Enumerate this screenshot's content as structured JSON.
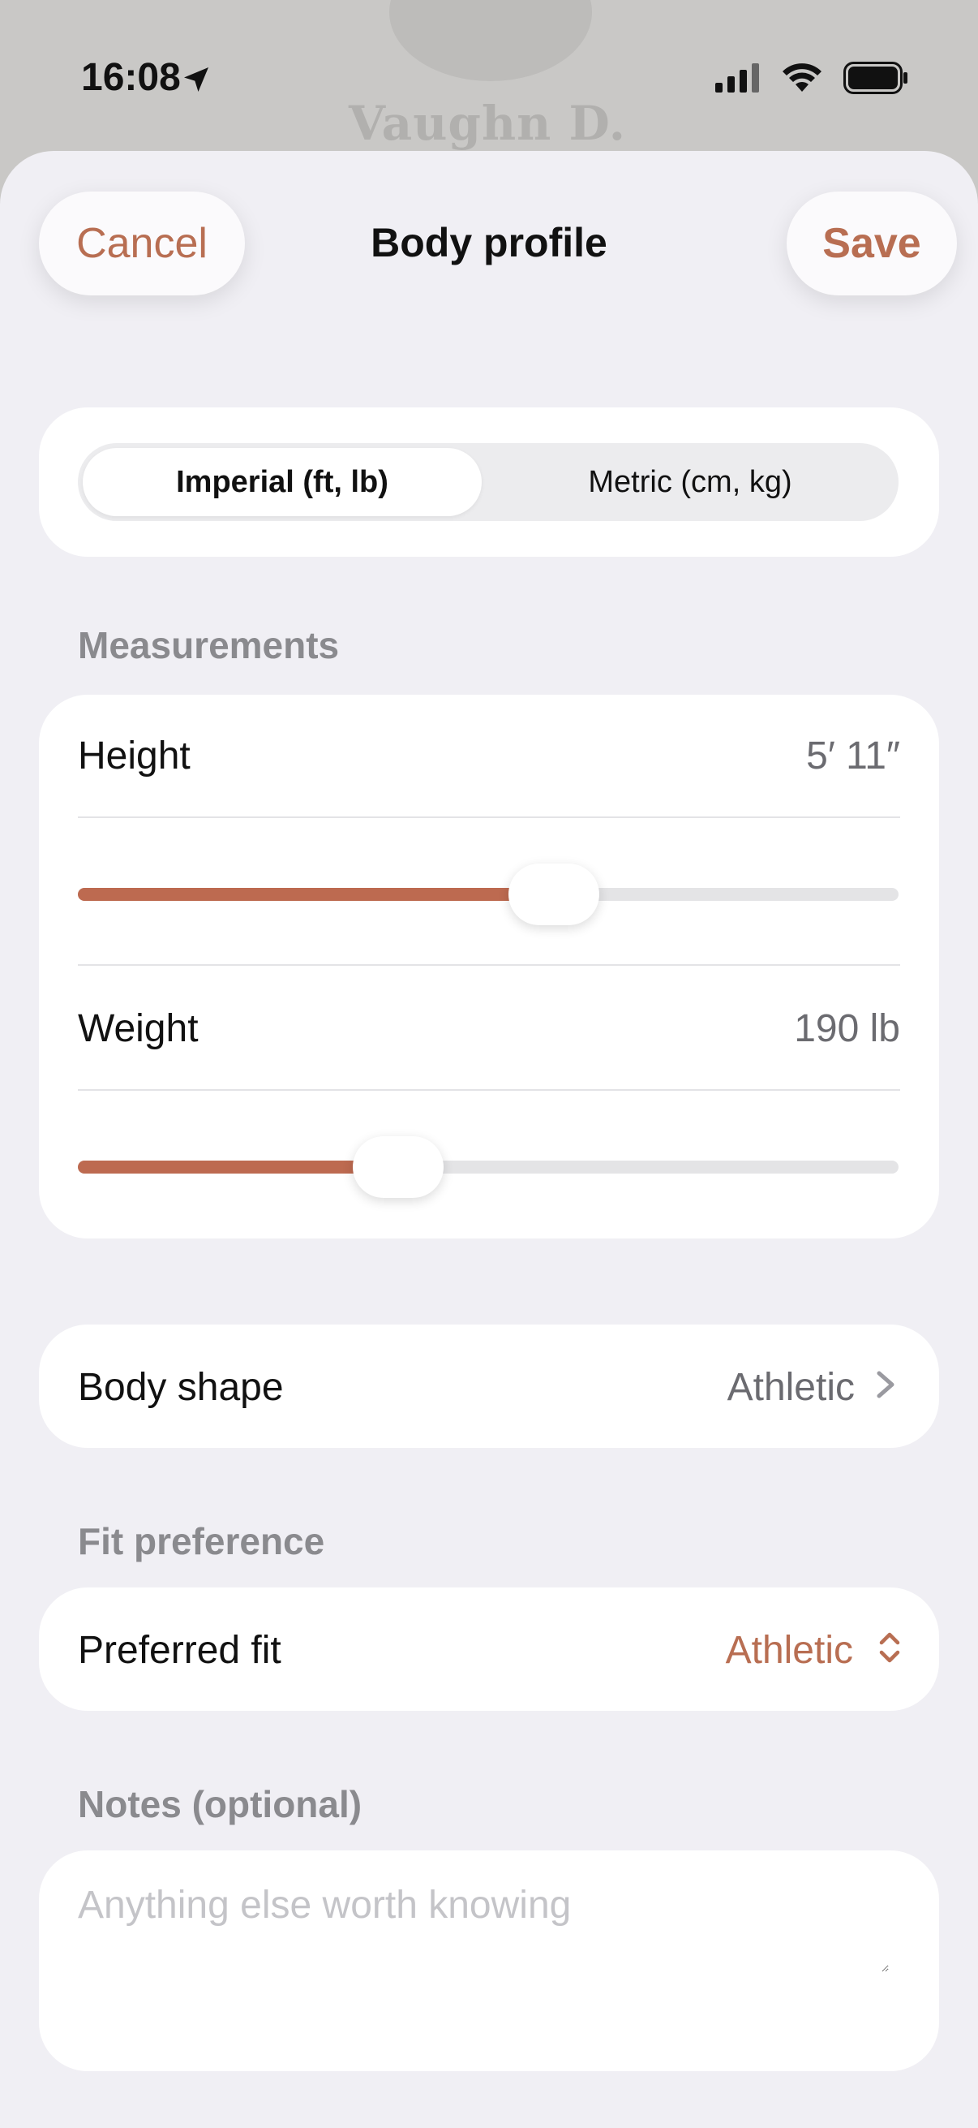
{
  "background": {
    "profile_name": "Vaughn D."
  },
  "status_bar": {
    "time": "16:08"
  },
  "header": {
    "cancel_label": "Cancel",
    "title": "Body profile",
    "save_label": "Save"
  },
  "units": {
    "options": [
      "Imperial (ft, lb)",
      "Metric (cm, kg)"
    ],
    "selected": "Imperial (ft, lb)"
  },
  "measurements": {
    "section_title": "Measurements",
    "height": {
      "label": "Height",
      "value": "5′ 11″",
      "slider_fraction": 0.58
    },
    "weight": {
      "label": "Weight",
      "value": "190 lb",
      "slider_fraction": 0.39
    }
  },
  "body_shape": {
    "label": "Body shape",
    "value": "Athletic"
  },
  "fit_preference": {
    "section_title": "Fit preference",
    "label": "Preferred fit",
    "value": "Athletic"
  },
  "notes": {
    "section_title": "Notes (optional)",
    "placeholder": "Anything else worth knowing",
    "value": ""
  },
  "colors": {
    "accent": "#bd6a50",
    "sheet_bg": "#f0eff4",
    "card_bg": "#ffffff",
    "secondary_text": "#8a8a8e"
  }
}
